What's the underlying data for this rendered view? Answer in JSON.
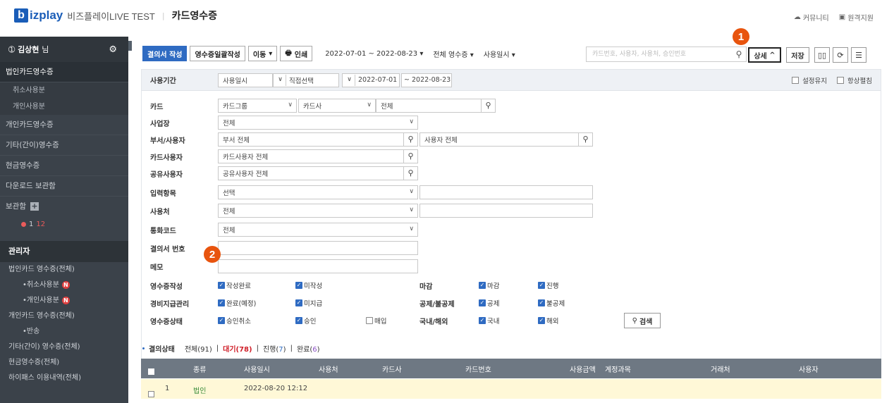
{
  "app": {
    "logo_letter": "b",
    "logo_name": "izplay",
    "logo_sub": "비즈플레이LIVE TEST",
    "separator": "|",
    "page_title": "카드영수증",
    "top_links": [
      {
        "icon": "community-icon",
        "label": "커뮤니티"
      },
      {
        "icon": "remote-support-icon",
        "label": "원격지원"
      }
    ]
  },
  "sidebar": {
    "user": "김상현",
    "user_suffix": "님",
    "items": [
      {
        "label": "법인카드영수증",
        "active": true
      },
      {
        "label": "취소사용분",
        "sub": true
      },
      {
        "label": "개인사용분",
        "sub": true
      },
      {
        "label": "개인카드영수증"
      },
      {
        "label": "기타(간이)영수증"
      },
      {
        "label": "현금영수증"
      },
      {
        "label": "다운로드 보관함"
      },
      {
        "label": "보관함"
      }
    ],
    "storage_count_a": "1",
    "storage_count_b": "12",
    "admin_title": "관리자",
    "admin_items": [
      {
        "label": "법인카드 영수증(전체)"
      },
      {
        "label": "•취소사용분",
        "sub": true,
        "badge": "N"
      },
      {
        "label": "•개인사용분",
        "sub": true,
        "badge": "N"
      },
      {
        "label": "개인카드 영수증(전체)"
      },
      {
        "label": "•반송",
        "sub": true
      },
      {
        "label": "기타(간이) 영수증(전체)"
      },
      {
        "label": "현금영수증(전체)"
      },
      {
        "label": "하이패스 이용내역(전체)"
      }
    ]
  },
  "toolbar": {
    "write_btn": "결의서 작성",
    "bulk_btn": "영수증일괄작성",
    "move_btn": "이동",
    "print_btn": "인쇄",
    "date_range": "2022-07-01 ~ 2022-08-23 ▾",
    "receipt_filter": "전체 영수증 ▾",
    "date_type": "사용일시 ▾",
    "search_placeholder": "카드번호, 사용자, 사용처, 승인번호",
    "detail_btn": "상세",
    "save_btn": "저장"
  },
  "callouts": [
    "1",
    "2"
  ],
  "filter": {
    "period_label": "사용기간",
    "period_type": "사용일시",
    "period_mode": "직접선택",
    "date_from": "2022-07-01",
    "date_to": "2022-08-23",
    "keep_setting": "설정유지",
    "always_open": "항상펼침",
    "card_label": "카드",
    "card_group": "카드그룹",
    "card_company": "카드사",
    "card_value": "전체",
    "site_label": "사업장",
    "site_value": "전체",
    "dept_label": "부서/사용자",
    "dept_value": "부서 전체",
    "user_value": "사용자 전체",
    "card_user_label": "카드사용자",
    "card_user_value": "카드사용자 전체",
    "share_label": "공유사용자",
    "share_value": "공유사용자 전체",
    "input_label": "입력항목",
    "input_value": "선택",
    "place_label": "사용처",
    "place_value": "전체",
    "currency_label": "통화코드",
    "currency_value": "전체",
    "resolution_label": "결의서 번호",
    "memo_label": "메모",
    "write_label": "영수증작성",
    "write_done": "작성완료",
    "write_not": "미작성",
    "close_label": "마감",
    "close_done": "마감",
    "close_progress": "진행",
    "expense_label": "경비지급관리",
    "expense_done": "완료(예정)",
    "expense_not": "미지급",
    "deduct_label": "공제/불공제",
    "deduct_yes": "공제",
    "deduct_no": "불공제",
    "status_label": "영수증상태",
    "status_cancel": "승인취소",
    "status_approve": "승인",
    "status_buy": "매입",
    "region_label": "국내/해외",
    "region_dom": "국내",
    "region_abroad": "해외",
    "search_btn": "검색"
  },
  "status": {
    "label": "결의상태",
    "all": "전체(91)",
    "wait": "대기(78)",
    "progress_pre": "진행(",
    "progress_num": "7",
    "progress_post": ")",
    "done_pre": "완료(",
    "done_num": "6",
    "done_post": ")",
    "sep": "|"
  },
  "table": {
    "headers": [
      "종류",
      "사용일시",
      "사용처",
      "카드사",
      "카드번호",
      "사용금액",
      "계정과목",
      "거래처",
      "사용자"
    ],
    "rows": [
      {
        "no": "1",
        "type": "법인",
        "datetime": "2022-08-20 12:12"
      }
    ]
  }
}
